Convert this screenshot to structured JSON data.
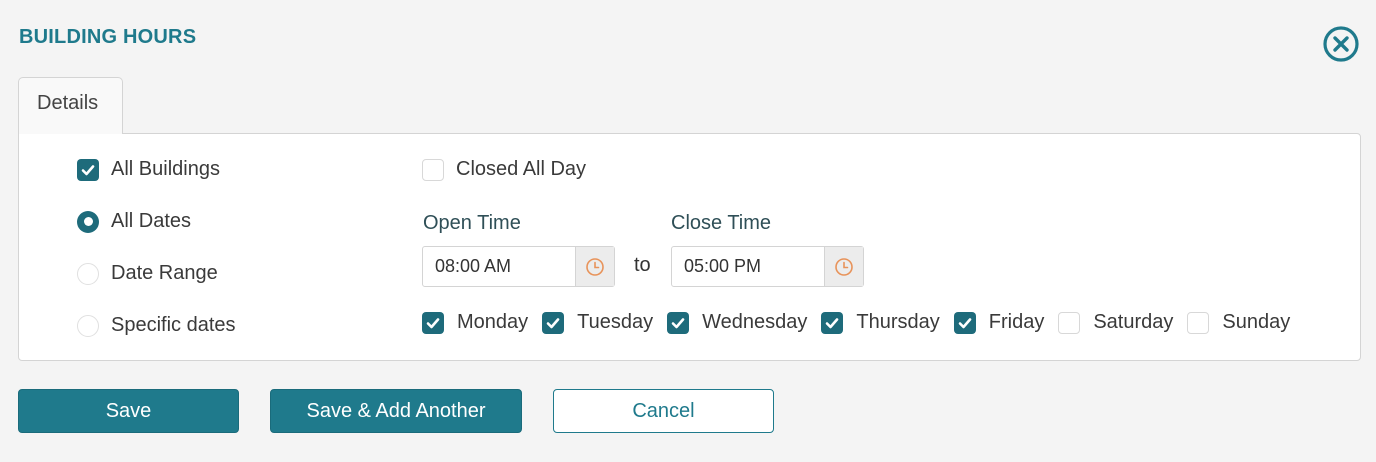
{
  "header": {
    "title": "BUILDING HOURS",
    "close_icon": "close-circle-icon"
  },
  "tabs": [
    {
      "label": "Details",
      "active": true
    }
  ],
  "scope": {
    "all_buildings": {
      "label": "All Buildings",
      "checked": true
    }
  },
  "date_options": [
    {
      "label": "All Dates",
      "selected": true
    },
    {
      "label": "Date Range",
      "selected": false
    },
    {
      "label": "Specific dates",
      "selected": false
    }
  ],
  "closed_all_day": {
    "label": "Closed All Day",
    "checked": false
  },
  "open_time": {
    "label": "Open Time",
    "value": "08:00 AM",
    "icon": "clock-icon"
  },
  "separator": "to",
  "close_time": {
    "label": "Close Time",
    "value": "05:00 PM",
    "icon": "clock-icon"
  },
  "days": [
    {
      "label": "Monday",
      "checked": true
    },
    {
      "label": "Tuesday",
      "checked": true
    },
    {
      "label": "Wednesday",
      "checked": true
    },
    {
      "label": "Thursday",
      "checked": true
    },
    {
      "label": "Friday",
      "checked": true
    },
    {
      "label": "Saturday",
      "checked": false
    },
    {
      "label": "Sunday",
      "checked": false
    }
  ],
  "actions": {
    "save": "Save",
    "save_add_another": "Save & Add Another",
    "cancel": "Cancel"
  },
  "colors": {
    "accent": "#1f7a8c",
    "checkbox_checked": "#1e6b7b",
    "clock_icon": "#e8935a",
    "background": "#f4f4f4",
    "panel": "#ffffff"
  }
}
